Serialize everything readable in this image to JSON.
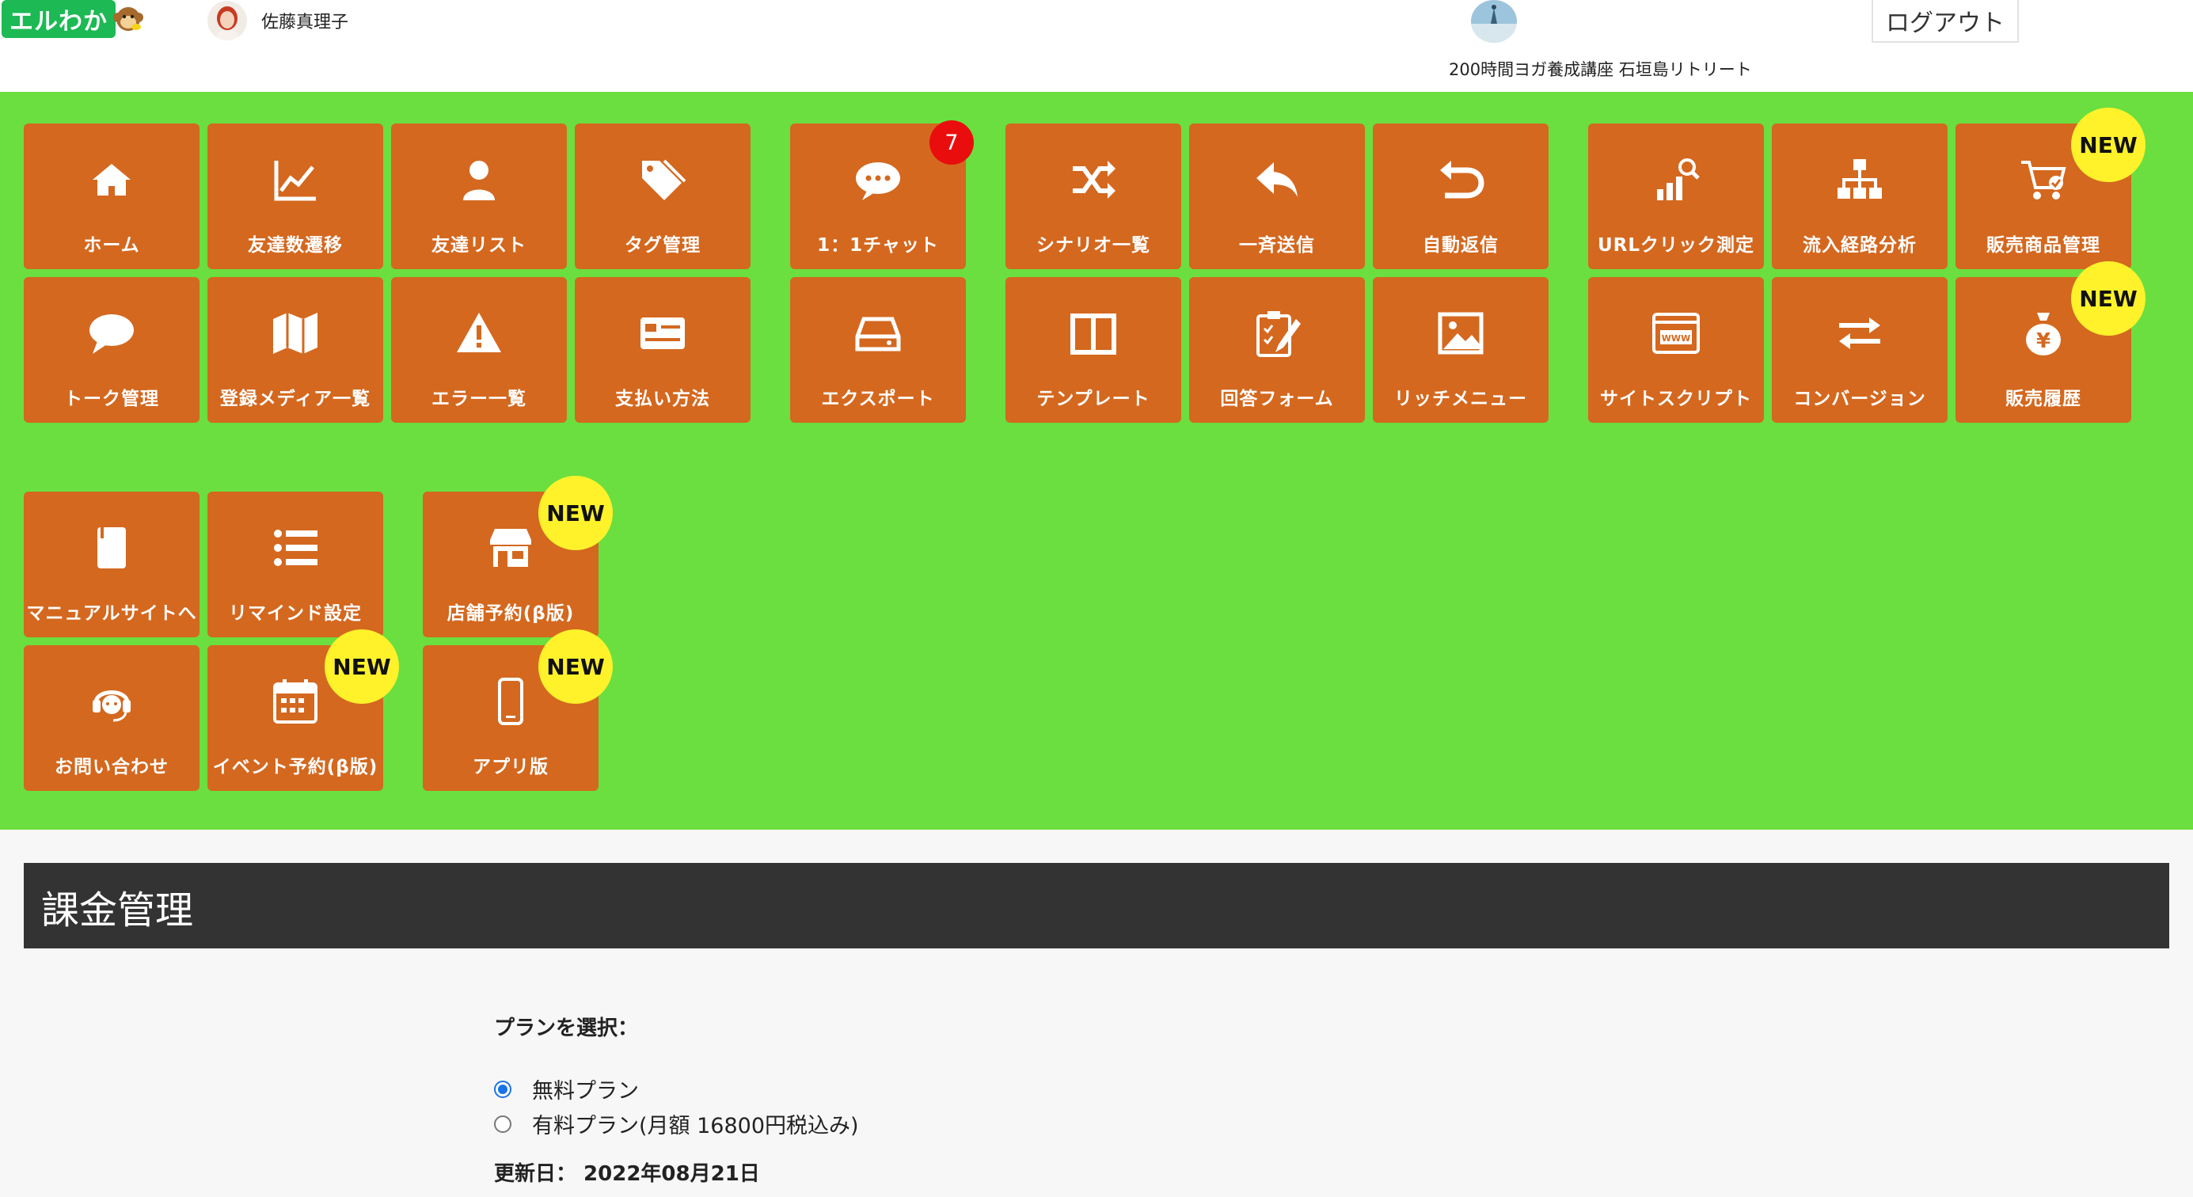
{
  "header": {
    "logo_text": "エルわか",
    "user_name": "佐藤真理子",
    "account_name": "200時間ヨガ養成講座 石垣島リトリート",
    "logout_label": "ログアウト"
  },
  "nav": {
    "home": "ホーム",
    "friend_trend": "友達数遷移",
    "friend_list": "友達リスト",
    "tag_manage": "タグ管理",
    "chat": "1：1チャット",
    "chat_badge": "7",
    "scenario_list": "シナリオ一覧",
    "broadcast": "一斉送信",
    "auto_reply": "自動返信",
    "url_click": "URLクリック測定",
    "inflow_analysis": "流入経路分析",
    "product_manage": "販売商品管理",
    "talk_manage": "トーク管理",
    "media_list": "登録メディア一覧",
    "error_list": "エラー一覧",
    "payment_method": "支払い方法",
    "export": "エクスポート",
    "template": "テンプレート",
    "answer_form": "回答フォーム",
    "rich_menu": "リッチメニュー",
    "site_script": "サイトスクリプト",
    "conversion": "コンバージョン",
    "sales_history": "販売履歴",
    "manual_site": "マニュアルサイトへ",
    "remind_setting": "リマインド設定",
    "store_reservation": "店舗予約(β版)",
    "contact": "お問い合わせ",
    "event_reservation": "イベント予約(β版)",
    "app_version": "アプリ版",
    "new_label": "NEW"
  },
  "billing": {
    "title": "課金管理",
    "select_label": "プランを選択：",
    "free_plan": "無料プラン",
    "paid_plan": "有料プラン(月額 16800円税込み)",
    "selected": "free",
    "update_date": "更新日： 2022年08月21日"
  },
  "colors": {
    "nav_bg": "#6adf3f",
    "tile": "#d4681f",
    "new_badge": "#fff22b",
    "count_badge": "#ea0d0d",
    "section_bar": "#333333"
  }
}
